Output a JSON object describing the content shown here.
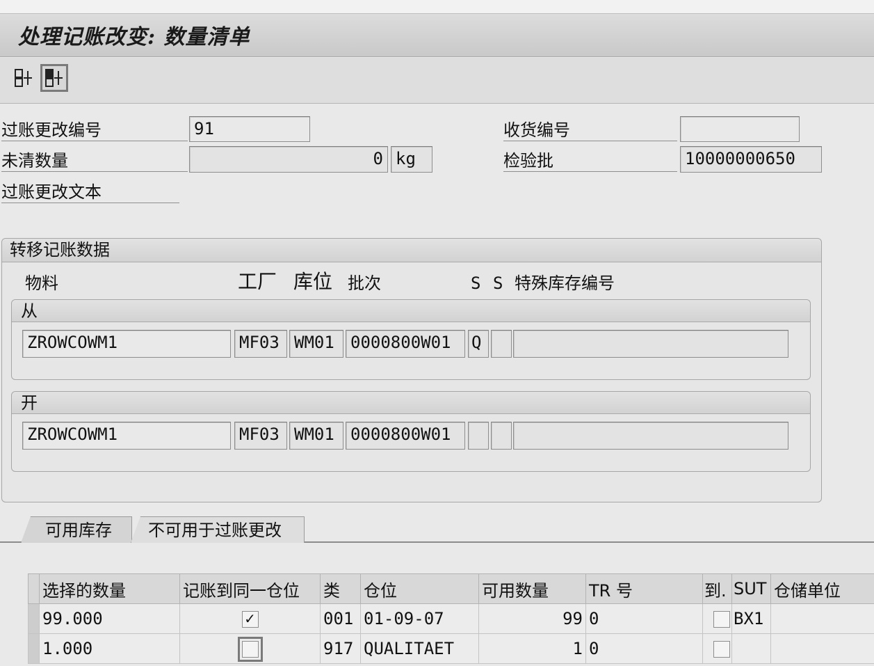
{
  "header": {
    "title": "处理记账改变: 数量清单"
  },
  "toolbar": {
    "buttons": [
      "layout-icon",
      "layout-active-icon"
    ]
  },
  "form": {
    "posting_change_no_label": "过账更改编号",
    "posting_change_no_value": "91",
    "open_qty_label": "未清数量",
    "open_qty_value": "0",
    "open_qty_unit": "kg",
    "posting_change_text_label": "过账更改文本",
    "gr_no_label": "收货编号",
    "gr_no_value": "",
    "inspection_lot_label": "检验批",
    "inspection_lot_value": "10000000650"
  },
  "transfer": {
    "title": "转移记账数据",
    "headers": {
      "material": "物料",
      "plant": "工厂",
      "sloc": "库位",
      "batch": "批次",
      "s1": "S",
      "s2": "S",
      "special_stock": "特殊库存编号"
    },
    "from": {
      "label": "从",
      "material": "ZROWCOWM1",
      "plant": "MF03",
      "sloc": "WM01",
      "batch": "0000800W01",
      "s1": "Q",
      "s2": "",
      "special_stock": ""
    },
    "to": {
      "label": "开",
      "material": "ZROWCOWM1",
      "plant": "MF03",
      "sloc": "WM01",
      "batch": "0000800W01",
      "s1": "",
      "s2": "",
      "special_stock": ""
    }
  },
  "tabs": [
    {
      "label": "可用库存",
      "active": true
    },
    {
      "label": "不可用于过账更改",
      "active": false
    }
  ],
  "table": {
    "columns": [
      "选择的数量",
      "记账到同一仓位",
      "类",
      "仓位",
      "可用数量",
      "TR 号",
      "到.",
      "SUT",
      "仓储单位"
    ],
    "rows": [
      {
        "qty": "99.000",
        "same_bin": true,
        "type": "001",
        "bin": "01-09-07",
        "avail": "99",
        "tr": "0",
        "arrive": false,
        "sut": "BX1",
        "su": ""
      },
      {
        "qty": "1.000",
        "same_bin": false,
        "type": "917",
        "bin": "QUALITAET",
        "avail": "1",
        "tr": "0",
        "arrive": false,
        "sut": "",
        "su": ""
      }
    ]
  }
}
